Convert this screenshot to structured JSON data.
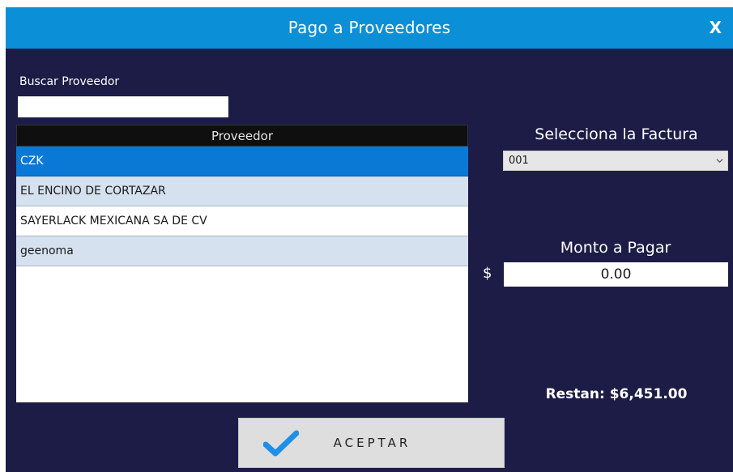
{
  "window": {
    "title": "Pago a Proveedores",
    "close_label": "X"
  },
  "search": {
    "label": "Buscar Proveedor",
    "value": ""
  },
  "grid": {
    "header": "Proveedor",
    "rows": [
      "CZK",
      "EL ENCINO DE CORTAZAR",
      "SAYERLACK MEXICANA SA DE CV",
      "geenoma"
    ],
    "selected_row": "CZK"
  },
  "factura": {
    "label": "Selecciona la Factura",
    "selected": "001",
    "icon": "chevron-down-icon"
  },
  "monto": {
    "label": "Monto a Pagar",
    "currency": "$",
    "value": "0.00"
  },
  "restan": {
    "text": "Restan: $6,451.00"
  },
  "accept_button": {
    "label": "ACEPTAR",
    "icon": "checkmark-icon"
  },
  "colors": {
    "titlebar": "#0b8fd6",
    "background": "#1c1c47",
    "selected_row": "#0a79d6",
    "alt_row": "#d5e1ef",
    "check": "#1e90e8"
  }
}
